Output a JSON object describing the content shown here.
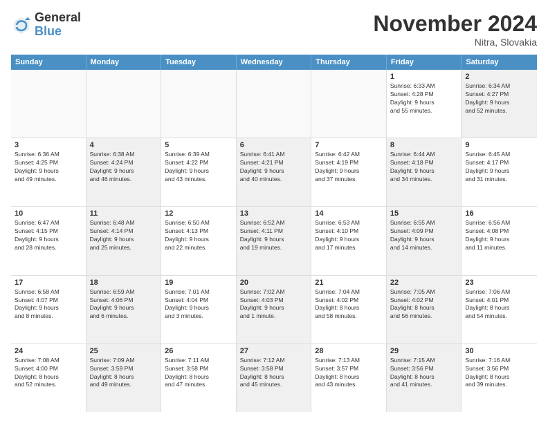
{
  "logo": {
    "general": "General",
    "blue": "Blue"
  },
  "title": "November 2024",
  "location": "Nitra, Slovakia",
  "days_of_week": [
    "Sunday",
    "Monday",
    "Tuesday",
    "Wednesday",
    "Thursday",
    "Friday",
    "Saturday"
  ],
  "weeks": [
    [
      {
        "day": "",
        "info": "",
        "empty": true
      },
      {
        "day": "",
        "info": "",
        "empty": true
      },
      {
        "day": "",
        "info": "",
        "empty": true
      },
      {
        "day": "",
        "info": "",
        "empty": true
      },
      {
        "day": "",
        "info": "",
        "empty": true
      },
      {
        "day": "1",
        "info": "Sunrise: 6:33 AM\nSunset: 4:28 PM\nDaylight: 9 hours\nand 55 minutes.",
        "shaded": false
      },
      {
        "day": "2",
        "info": "Sunrise: 6:34 AM\nSunset: 4:27 PM\nDaylight: 9 hours\nand 52 minutes.",
        "shaded": true
      }
    ],
    [
      {
        "day": "3",
        "info": "Sunrise: 6:36 AM\nSunset: 4:25 PM\nDaylight: 9 hours\nand 49 minutes.",
        "shaded": false
      },
      {
        "day": "4",
        "info": "Sunrise: 6:38 AM\nSunset: 4:24 PM\nDaylight: 9 hours\nand 46 minutes.",
        "shaded": true
      },
      {
        "day": "5",
        "info": "Sunrise: 6:39 AM\nSunset: 4:22 PM\nDaylight: 9 hours\nand 43 minutes.",
        "shaded": false
      },
      {
        "day": "6",
        "info": "Sunrise: 6:41 AM\nSunset: 4:21 PM\nDaylight: 9 hours\nand 40 minutes.",
        "shaded": true
      },
      {
        "day": "7",
        "info": "Sunrise: 6:42 AM\nSunset: 4:19 PM\nDaylight: 9 hours\nand 37 minutes.",
        "shaded": false
      },
      {
        "day": "8",
        "info": "Sunrise: 6:44 AM\nSunset: 4:18 PM\nDaylight: 9 hours\nand 34 minutes.",
        "shaded": true
      },
      {
        "day": "9",
        "info": "Sunrise: 6:45 AM\nSunset: 4:17 PM\nDaylight: 9 hours\nand 31 minutes.",
        "shaded": false
      }
    ],
    [
      {
        "day": "10",
        "info": "Sunrise: 6:47 AM\nSunset: 4:15 PM\nDaylight: 9 hours\nand 28 minutes.",
        "shaded": false
      },
      {
        "day": "11",
        "info": "Sunrise: 6:48 AM\nSunset: 4:14 PM\nDaylight: 9 hours\nand 25 minutes.",
        "shaded": true
      },
      {
        "day": "12",
        "info": "Sunrise: 6:50 AM\nSunset: 4:13 PM\nDaylight: 9 hours\nand 22 minutes.",
        "shaded": false
      },
      {
        "day": "13",
        "info": "Sunrise: 6:52 AM\nSunset: 4:11 PM\nDaylight: 9 hours\nand 19 minutes.",
        "shaded": true
      },
      {
        "day": "14",
        "info": "Sunrise: 6:53 AM\nSunset: 4:10 PM\nDaylight: 9 hours\nand 17 minutes.",
        "shaded": false
      },
      {
        "day": "15",
        "info": "Sunrise: 6:55 AM\nSunset: 4:09 PM\nDaylight: 9 hours\nand 14 minutes.",
        "shaded": true
      },
      {
        "day": "16",
        "info": "Sunrise: 6:56 AM\nSunset: 4:08 PM\nDaylight: 9 hours\nand 11 minutes.",
        "shaded": false
      }
    ],
    [
      {
        "day": "17",
        "info": "Sunrise: 6:58 AM\nSunset: 4:07 PM\nDaylight: 9 hours\nand 8 minutes.",
        "shaded": false
      },
      {
        "day": "18",
        "info": "Sunrise: 6:59 AM\nSunset: 4:06 PM\nDaylight: 9 hours\nand 6 minutes.",
        "shaded": true
      },
      {
        "day": "19",
        "info": "Sunrise: 7:01 AM\nSunset: 4:04 PM\nDaylight: 9 hours\nand 3 minutes.",
        "shaded": false
      },
      {
        "day": "20",
        "info": "Sunrise: 7:02 AM\nSunset: 4:03 PM\nDaylight: 9 hours\nand 1 minute.",
        "shaded": true
      },
      {
        "day": "21",
        "info": "Sunrise: 7:04 AM\nSunset: 4:02 PM\nDaylight: 8 hours\nand 58 minutes.",
        "shaded": false
      },
      {
        "day": "22",
        "info": "Sunrise: 7:05 AM\nSunset: 4:02 PM\nDaylight: 8 hours\nand 56 minutes.",
        "shaded": true
      },
      {
        "day": "23",
        "info": "Sunrise: 7:06 AM\nSunset: 4:01 PM\nDaylight: 8 hours\nand 54 minutes.",
        "shaded": false
      }
    ],
    [
      {
        "day": "24",
        "info": "Sunrise: 7:08 AM\nSunset: 4:00 PM\nDaylight: 8 hours\nand 52 minutes.",
        "shaded": false
      },
      {
        "day": "25",
        "info": "Sunrise: 7:09 AM\nSunset: 3:59 PM\nDaylight: 8 hours\nand 49 minutes.",
        "shaded": true
      },
      {
        "day": "26",
        "info": "Sunrise: 7:11 AM\nSunset: 3:58 PM\nDaylight: 8 hours\nand 47 minutes.",
        "shaded": false
      },
      {
        "day": "27",
        "info": "Sunrise: 7:12 AM\nSunset: 3:58 PM\nDaylight: 8 hours\nand 45 minutes.",
        "shaded": true
      },
      {
        "day": "28",
        "info": "Sunrise: 7:13 AM\nSunset: 3:57 PM\nDaylight: 8 hours\nand 43 minutes.",
        "shaded": false
      },
      {
        "day": "29",
        "info": "Sunrise: 7:15 AM\nSunset: 3:56 PM\nDaylight: 8 hours\nand 41 minutes.",
        "shaded": true
      },
      {
        "day": "30",
        "info": "Sunrise: 7:16 AM\nSunset: 3:56 PM\nDaylight: 8 hours\nand 39 minutes.",
        "shaded": false
      }
    ]
  ]
}
